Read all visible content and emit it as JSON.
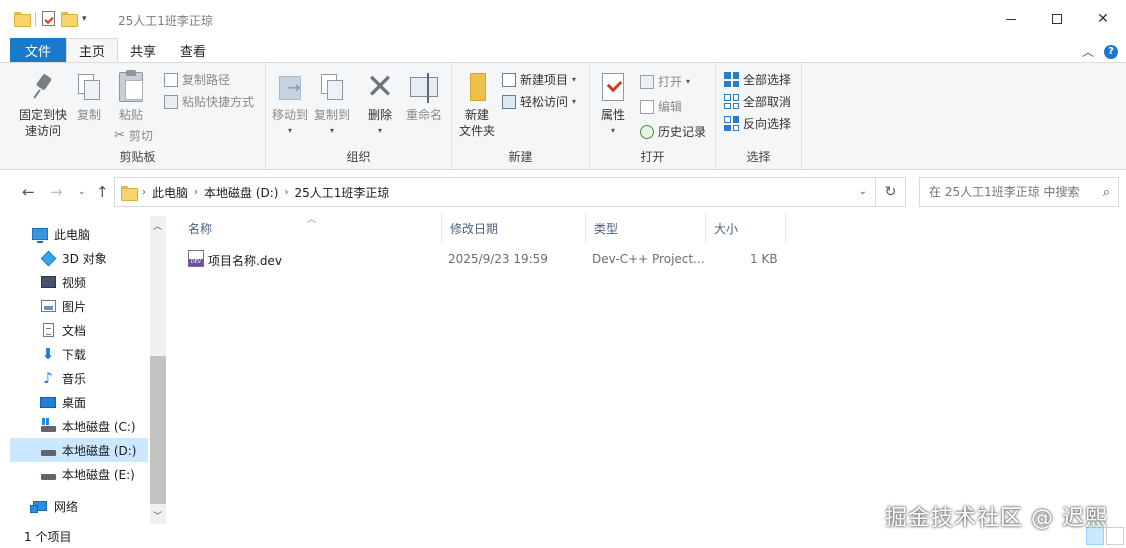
{
  "window": {
    "title": "25人工1班李正琼",
    "controls": [
      "minimize",
      "maximize",
      "close"
    ]
  },
  "ribbon_tabs": [
    {
      "label": "文件",
      "active": false
    },
    {
      "label": "主页",
      "active": true
    },
    {
      "label": "共享",
      "active": false
    },
    {
      "label": "查看",
      "active": false
    }
  ],
  "ribbon": {
    "clipboard": {
      "label": "剪贴板",
      "pin_line1": "固定到快",
      "pin_line2": "速访问",
      "copy": "复制",
      "paste": "粘贴",
      "copy_path": "复制路径",
      "paste_shortcut": "粘贴快捷方式",
      "cut": "剪切"
    },
    "organize": {
      "label": "组织",
      "move_to": "移动到",
      "copy_to": "复制到",
      "delete": "删除",
      "rename": "重命名"
    },
    "new": {
      "label": "新建",
      "new_folder_line1": "新建",
      "new_folder_line2": "文件夹",
      "new_item": "新建项目",
      "easy_access": "轻松访问"
    },
    "open": {
      "label": "打开",
      "properties": "属性",
      "open": "打开",
      "edit": "编辑",
      "history": "历史记录"
    },
    "select": {
      "label": "选择",
      "select_all": "全部选择",
      "select_none": "全部取消",
      "invert": "反向选择"
    }
  },
  "address_bar": {
    "crumbs": [
      "此电脑",
      "本地磁盘 (D:)",
      "25人工1班李正琼"
    ]
  },
  "search": {
    "placeholder": "在 25人工1班李正琼 中搜索"
  },
  "nav_pane": {
    "items": [
      {
        "label": "此电脑",
        "icon": "computer-icon",
        "level": 0,
        "selected": false
      },
      {
        "label": "3D 对象",
        "icon": "3d-objects-icon",
        "level": 1,
        "selected": false
      },
      {
        "label": "视频",
        "icon": "video-icon",
        "level": 1,
        "selected": false
      },
      {
        "label": "图片",
        "icon": "pictures-icon",
        "level": 1,
        "selected": false
      },
      {
        "label": "文档",
        "icon": "documents-icon",
        "level": 1,
        "selected": false
      },
      {
        "label": "下载",
        "icon": "downloads-icon",
        "level": 1,
        "selected": false
      },
      {
        "label": "音乐",
        "icon": "music-icon",
        "level": 1,
        "selected": false
      },
      {
        "label": "桌面",
        "icon": "desktop-icon",
        "level": 1,
        "selected": false
      },
      {
        "label": "本地磁盘 (C:)",
        "icon": "system-drive-icon",
        "level": 1,
        "selected": false
      },
      {
        "label": "本地磁盘 (D:)",
        "icon": "drive-icon",
        "level": 1,
        "selected": true
      },
      {
        "label": "本地磁盘 (E:)",
        "icon": "drive-icon",
        "level": 1,
        "selected": false
      },
      {
        "label": "网络",
        "icon": "network-icon",
        "level": 0,
        "selected": false
      }
    ]
  },
  "file_list": {
    "columns": [
      "名称",
      "修改日期",
      "类型",
      "大小"
    ],
    "rows": [
      {
        "name": "项目名称.dev",
        "modified": "2025/9/23 19:59",
        "type": "Dev-C++ Project...",
        "size": "1 KB",
        "icon": "dev-project-icon"
      }
    ]
  },
  "status": {
    "item_count": "1 个项目"
  },
  "watermark": "掘金技术社区 @ 迟熙",
  "colors": {
    "file_tab": "#1979ca",
    "ribbon_bg": "#f5f6f7",
    "selection": "#cce8ff",
    "column_header_text": "#4c607a"
  }
}
